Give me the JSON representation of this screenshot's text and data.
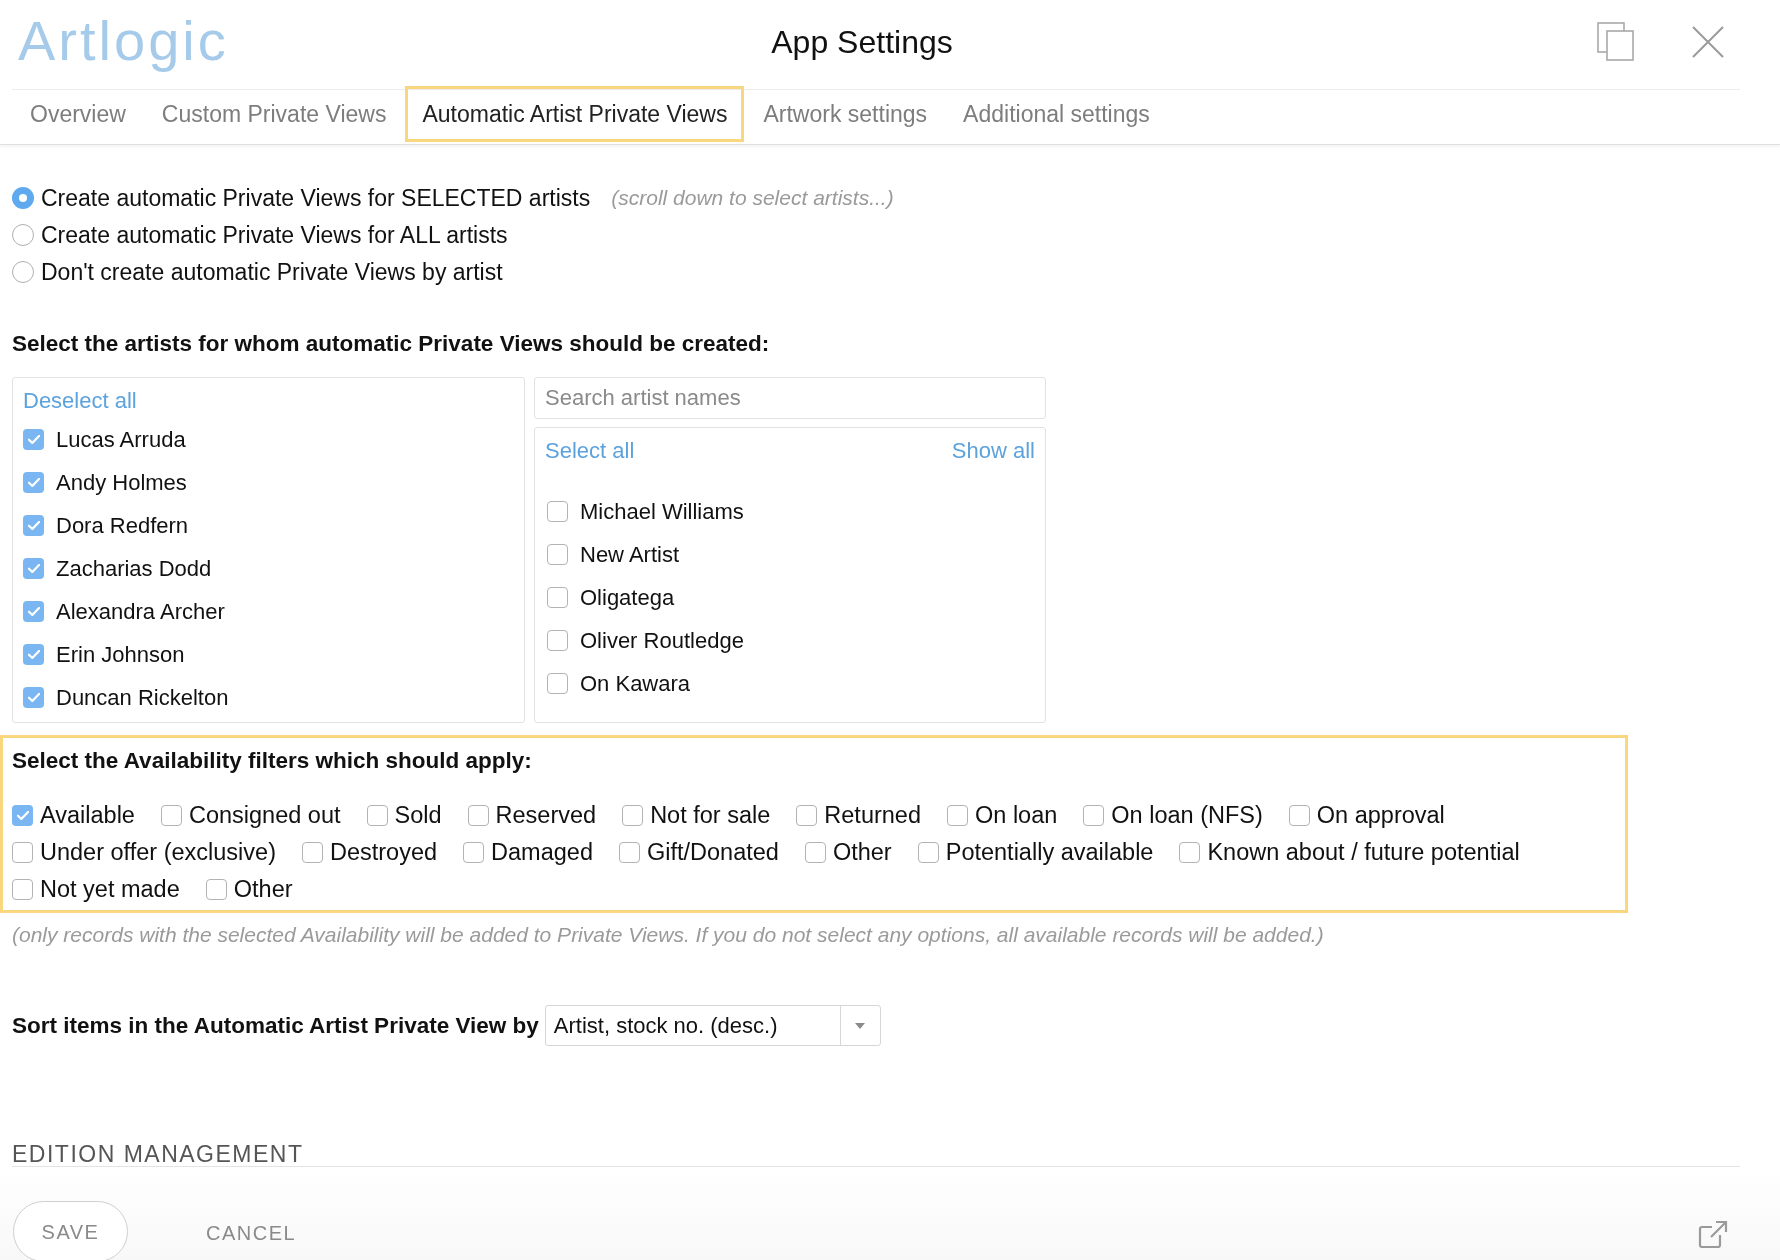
{
  "header": {
    "logo": "Artlogic",
    "title": "App Settings"
  },
  "tabs": [
    {
      "label": "Overview",
      "selected": false
    },
    {
      "label": "Custom Private Views",
      "selected": false
    },
    {
      "label": "Automatic Artist Private Views",
      "selected": true
    },
    {
      "label": "Artwork settings",
      "selected": false
    },
    {
      "label": "Additional settings",
      "selected": false
    }
  ],
  "creation_mode": {
    "options": [
      {
        "label": "Create automatic Private Views for SELECTED artists",
        "selected": true,
        "hint": "(scroll down to select artists...)"
      },
      {
        "label": "Create automatic Private Views for ALL artists",
        "selected": false
      },
      {
        "label": "Don't create automatic Private Views by artist",
        "selected": false
      }
    ]
  },
  "artist_selection": {
    "heading": "Select the artists for whom automatic Private Views should be created:",
    "chosen": {
      "action": "Deselect all",
      "artists": [
        {
          "name": "Lucas Arruda",
          "checked": true
        },
        {
          "name": "Andy Holmes",
          "checked": true
        },
        {
          "name": "Dora Redfern",
          "checked": true
        },
        {
          "name": "Zacharias Dodd",
          "checked": true
        },
        {
          "name": "Alexandra Archer",
          "checked": true
        },
        {
          "name": "Erin Johnson",
          "checked": true
        },
        {
          "name": "Duncan Rickelton",
          "checked": true
        }
      ]
    },
    "search": {
      "placeholder": "Search artist names"
    },
    "available": {
      "select_action": "Select all",
      "show_action": "Show all",
      "artists": [
        {
          "name": "Michael Williams",
          "checked": false
        },
        {
          "name": "New Artist",
          "checked": false
        },
        {
          "name": "Oligatega",
          "checked": false
        },
        {
          "name": "Oliver Routledge",
          "checked": false
        },
        {
          "name": "On Kawara",
          "checked": false
        }
      ]
    }
  },
  "availability": {
    "highlighted": true,
    "heading": "Select the Availability filters which should apply:",
    "rows": [
      {
        "options": [
          {
            "label": "Available",
            "checked": true
          },
          {
            "label": "Consigned out",
            "checked": false
          },
          {
            "label": "Sold",
            "checked": false
          },
          {
            "label": "Reserved",
            "checked": false
          },
          {
            "label": "Not for sale",
            "checked": false
          },
          {
            "label": "Returned",
            "checked": false
          },
          {
            "label": "On loan",
            "checked": false
          },
          {
            "label": "On loan (NFS)",
            "checked": false
          },
          {
            "label": "On approval",
            "checked": false
          }
        ]
      },
      {
        "options": [
          {
            "label": "Under offer (exclusive)",
            "checked": false
          },
          {
            "label": "Destroyed",
            "checked": false
          },
          {
            "label": "Damaged",
            "checked": false
          },
          {
            "label": "Gift/Donated",
            "checked": false
          },
          {
            "label": "Other",
            "checked": false
          },
          {
            "label": "Potentially available",
            "checked": false
          },
          {
            "label": "Known about / future potential",
            "checked": false
          }
        ]
      },
      {
        "options": [
          {
            "label": "Not yet made",
            "checked": false
          },
          {
            "label": "Other",
            "checked": false
          }
        ]
      }
    ],
    "note": "(only records with the selected Availability will be added to Private Views. If you do not select any options, all available records will be added.)"
  },
  "sort": {
    "label": "Sort items in the Automatic Artist Private View by",
    "value": "Artist, stock no. (desc.)"
  },
  "next_section": {
    "title": "EDITION MANAGEMENT"
  },
  "footer": {
    "save": "SAVE",
    "cancel": "CANCEL"
  }
}
